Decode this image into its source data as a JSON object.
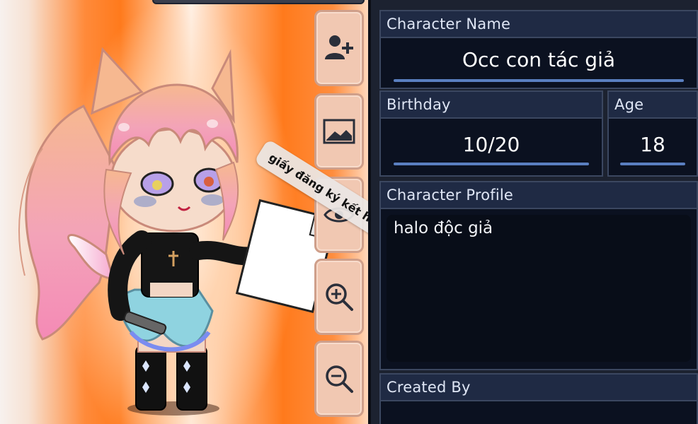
{
  "sticker": {
    "text": "giấy đăng ký kết hôn"
  },
  "toolbar": {
    "icons": [
      "add-user-icon",
      "image-icon",
      "eye-icon",
      "zoom-in-icon",
      "zoom-out-icon"
    ]
  },
  "fields": {
    "name_header": "Character Name",
    "name_value": "Occ con tác giả",
    "birthday_header": "Birthday",
    "birthday_value": "10/20",
    "age_header": "Age",
    "age_value": "18",
    "profile_header": "Character Profile",
    "profile_value": "halo độc giả",
    "created_header": "Created By",
    "created_value": ""
  },
  "colors": {
    "panel_bg": "#1c2230",
    "header_bg": "#1f2a44",
    "field_bg": "#0b1120",
    "accent_line": "#5a7fc0",
    "button_bg": "#f1c8b2"
  }
}
